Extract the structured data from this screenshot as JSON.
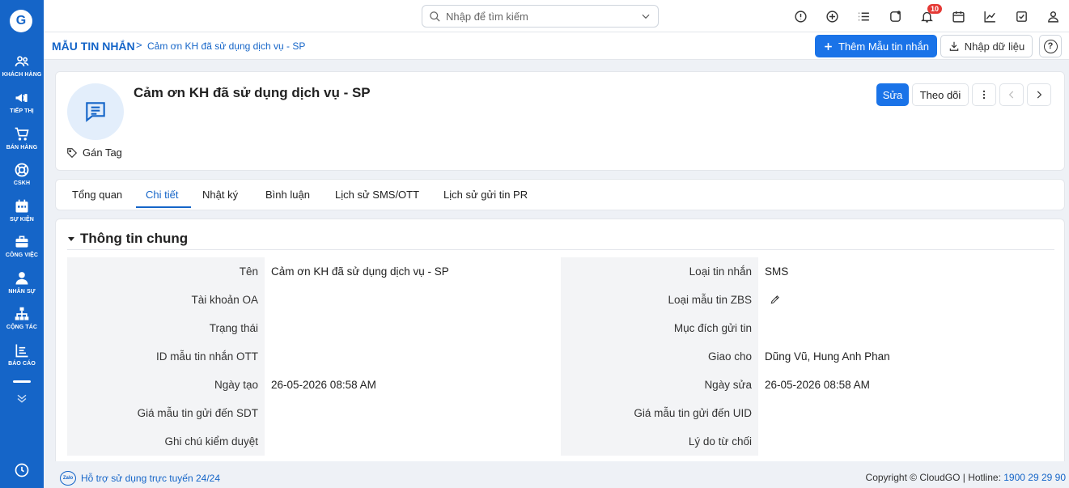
{
  "sidebar": {
    "logo": "G",
    "items": [
      {
        "label": "KHÁCH HÀNG",
        "icon": "users-icon"
      },
      {
        "label": "TIẾP THỊ",
        "icon": "megaphone-icon"
      },
      {
        "label": "BÁN HÀNG",
        "icon": "cart-icon"
      },
      {
        "label": "CSKH",
        "icon": "lifebuoy-icon"
      },
      {
        "label": "SỰ KIỆN",
        "icon": "calendar-icon"
      },
      {
        "label": "CÔNG VIỆC",
        "icon": "briefcase-icon"
      },
      {
        "label": "NHÂN SỰ",
        "icon": "person-icon"
      },
      {
        "label": "CỘNG TÁC",
        "icon": "org-chart-icon"
      },
      {
        "label": "BÁO CÁO",
        "icon": "report-icon"
      }
    ]
  },
  "topbar": {
    "search_placeholder": "Nhập để tìm kiếm",
    "notification_count": "10"
  },
  "breadcrumb": {
    "root": "MẪU TIN NHẮN",
    "separator": ">",
    "current": "Cảm ơn KH đã sử dụng dịch vụ - SP"
  },
  "actions": {
    "add_label": "Thêm Mẫu tin nhắn",
    "import_label": "Nhập dữ liệu",
    "help": "?"
  },
  "record": {
    "title": "Cảm ơn KH đã sử dụng dịch vụ - SP",
    "tag_label": "Gán Tag",
    "edit_label": "Sửa",
    "follow_label": "Theo dõi"
  },
  "tabs": [
    {
      "label": "Tổng quan"
    },
    {
      "label": "Chi tiết",
      "active": true
    },
    {
      "label": "Nhật ký"
    },
    {
      "label": "Bình luận"
    },
    {
      "label": "Lịch sử SMS/OTT"
    },
    {
      "label": "Lịch sử gửi tin PR"
    }
  ],
  "section": {
    "title": "Thông tin chung",
    "left": [
      {
        "label": "Tên",
        "value": "Cảm ơn KH đã sử dụng dịch vụ - SP"
      },
      {
        "label": "Tài khoản OA",
        "value": ""
      },
      {
        "label": "Trạng thái",
        "value": ""
      },
      {
        "label": "ID mẫu tin nhắn OTT",
        "value": ""
      },
      {
        "label": "Ngày tạo",
        "value": "26-05-2026 08:58 AM"
      },
      {
        "label": "Giá mẫu tin gửi đến SDT",
        "value": ""
      },
      {
        "label": "Ghi chú kiểm duyệt",
        "value": ""
      }
    ],
    "right": [
      {
        "label": "Loại tin nhắn",
        "value": "SMS"
      },
      {
        "label": "Loại mẫu tin ZBS",
        "value": ""
      },
      {
        "label": "Mục đích gửi tin",
        "value": ""
      },
      {
        "label": "Giao cho",
        "value": "Dũng Vũ, Hung Anh Phan"
      },
      {
        "label": "Ngày sửa",
        "value": "26-05-2026 08:58 AM"
      },
      {
        "label": "Giá mẫu tin gửi đến UID",
        "value": ""
      },
      {
        "label": "Lý do từ chối",
        "value": ""
      }
    ]
  },
  "footer": {
    "zalo": "Zalo",
    "support": "Hỗ trợ sử dụng trực tuyến 24/24",
    "copyright": "Copyright © CloudGO | Hotline: ",
    "hotline": "1900 29 29 90"
  }
}
